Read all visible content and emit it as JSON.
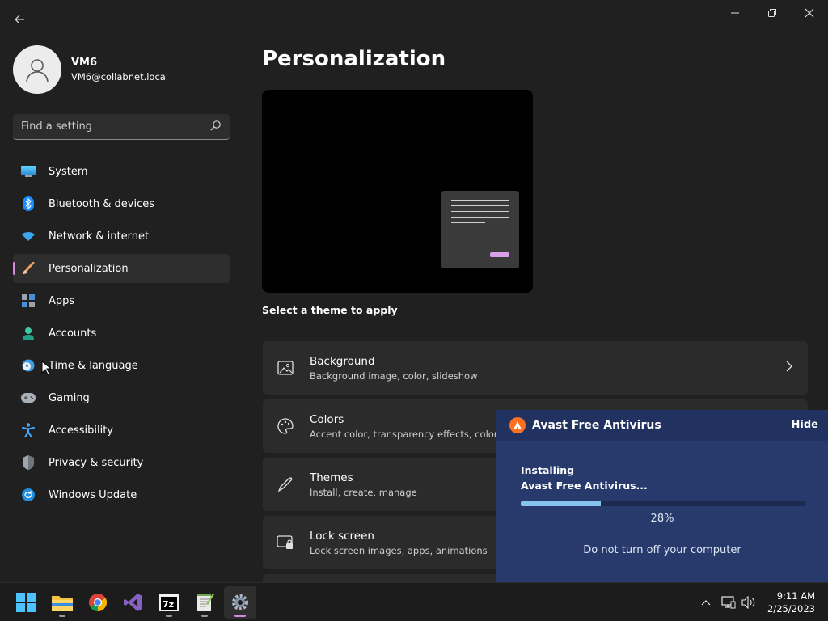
{
  "window": {
    "back_icon": "back-arrow-icon",
    "controls": [
      "minimize-icon",
      "restore-icon",
      "close-icon"
    ]
  },
  "profile": {
    "name": "VM6",
    "email": "VM6@collabnet.local"
  },
  "search": {
    "placeholder": "Find a setting"
  },
  "sidebar": {
    "items": [
      {
        "label": "System",
        "icon": "monitor-icon"
      },
      {
        "label": "Bluetooth & devices",
        "icon": "bluetooth-icon"
      },
      {
        "label": "Network & internet",
        "icon": "wifi-icon"
      },
      {
        "label": "Personalization",
        "icon": "brush-icon",
        "active": true
      },
      {
        "label": "Apps",
        "icon": "apps-icon"
      },
      {
        "label": "Accounts",
        "icon": "person-icon"
      },
      {
        "label": "Time & language",
        "icon": "clock-globe-icon"
      },
      {
        "label": "Gaming",
        "icon": "gamepad-icon"
      },
      {
        "label": "Accessibility",
        "icon": "accessibility-icon"
      },
      {
        "label": "Privacy & security",
        "icon": "shield-icon"
      },
      {
        "label": "Windows Update",
        "icon": "update-icon"
      }
    ]
  },
  "main": {
    "title": "Personalization",
    "theme_hint": "Select a theme to apply",
    "cards": [
      {
        "title": "Background",
        "subtitle": "Background image, color, slideshow",
        "icon": "image-icon"
      },
      {
        "title": "Colors",
        "subtitle": "Accent color, transparency effects, color theme",
        "icon": "palette-icon"
      },
      {
        "title": "Themes",
        "subtitle": "Install, create, manage",
        "icon": "pen-icon"
      },
      {
        "title": "Lock screen",
        "subtitle": "Lock screen images, apps, animations",
        "icon": "lock-screen-icon"
      }
    ]
  },
  "avast": {
    "title": "Avast Free Antivirus",
    "hide_label": "Hide",
    "installing_label": "Installing",
    "product_label": "Avast Free Antivirus...",
    "progress": 0.28,
    "progress_text": "28%",
    "warning": "Do not turn off your computer"
  },
  "taskbar": {
    "apps": [
      "windows-start-icon",
      "file-explorer-icon",
      "chrome-icon",
      "visual-studio-icon",
      "7zip-icon",
      "notepad-plus-plus-icon",
      "settings-gear-icon"
    ],
    "tray_icons": [
      "chevron-up-icon",
      "network-icon",
      "volume-icon"
    ],
    "time": "9:11 AM",
    "date": "2/25/2023"
  },
  "colors": {
    "accent": "#d88ad8",
    "avast_bg": "#283a6b",
    "avast_orange": "#ff7021",
    "progress_fill": "#87c3f0"
  }
}
